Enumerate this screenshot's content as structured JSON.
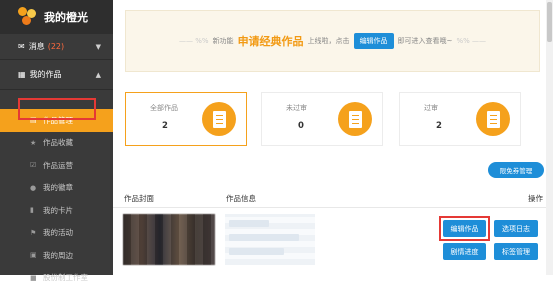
{
  "app": {
    "logo_text": "我的橙光"
  },
  "sidebar": {
    "messages": {
      "label": "消息",
      "count": "(22)"
    },
    "my_works": {
      "label": "我的作品"
    },
    "items": [
      {
        "label": "作品管理",
        "icon": "list-icon"
      },
      {
        "label": "作品收藏",
        "icon": "star-icon"
      },
      {
        "label": "作品运营",
        "icon": "checkbox-icon"
      },
      {
        "label": "我的徽章",
        "icon": "badge-icon"
      },
      {
        "label": "我的卡片",
        "icon": "card-icon"
      },
      {
        "label": "我的活动",
        "icon": "activity-icon"
      },
      {
        "label": "我的周边",
        "icon": "merch-icon"
      },
      {
        "label": "股份制工作室",
        "icon": "studio-icon"
      }
    ]
  },
  "banner": {
    "new_feature": "新功能",
    "title": "申请经典作品",
    "text_online": "上线啦，点击",
    "button": "编辑作品",
    "text_after": "即可进入查看哦~"
  },
  "stats": [
    {
      "label": "全部作品",
      "value": "2"
    },
    {
      "label": "未过审",
      "value": "0"
    },
    {
      "label": "过审",
      "value": "2"
    }
  ],
  "agency_button": "限免券管理",
  "table": {
    "headers": {
      "cover": "作品封面",
      "info": "作品信息",
      "ops": "操作"
    },
    "row": {
      "buttons": {
        "edit": "编辑作品",
        "log": "选项日志",
        "progress": "剧情进度",
        "tags": "标签管理"
      }
    }
  },
  "colors": {
    "accent": "#f5a11c",
    "blue": "#1e8ed8",
    "highlight": "#e53935"
  }
}
